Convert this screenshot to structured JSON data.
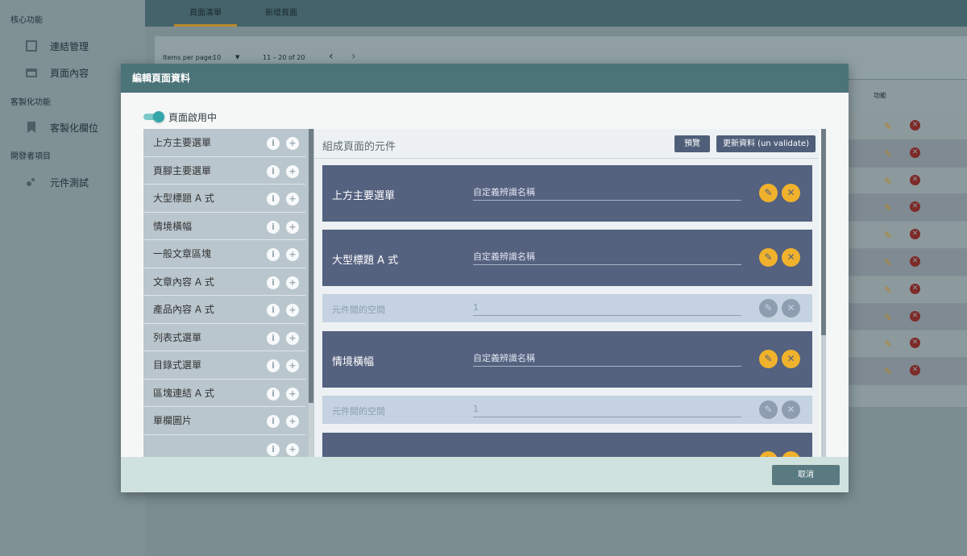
{
  "sidebar": {
    "sections": [
      {
        "label": "核心功能",
        "items": [
          {
            "label": "連結管理",
            "icon": "link-icon"
          },
          {
            "label": "頁面內容",
            "icon": "page-icon"
          }
        ]
      },
      {
        "label": "客製化功能",
        "items": [
          {
            "label": "客製化欄位",
            "icon": "bookmark-icon"
          }
        ]
      },
      {
        "label": "開發者項目",
        "items": [
          {
            "label": "元件測試",
            "icon": "bubbles-icon"
          }
        ]
      }
    ]
  },
  "topbar": {
    "tabs": [
      "頁面清單",
      "新增頁面"
    ]
  },
  "pager": {
    "items_per_page_label": "Items per page:",
    "items_per_page_value": "10",
    "range": "11 – 20 of 20",
    "prev": "‹",
    "next": "›"
  },
  "table": {
    "actions_header": "功能"
  },
  "modal": {
    "title": "編輯頁面資料",
    "toggle_label": "頁面啟用中",
    "component_list": [
      "上方主要選單",
      "頁腳主要選單",
      "大型標題 A 式",
      "情境橫幅",
      "一般文章區塊",
      "文章內容 A 式",
      "產品內容 A 式",
      "列表式選單",
      "目錄式選單",
      "區塊連結 A 式",
      "單欄圖片"
    ],
    "compose": {
      "title": "組成頁面的元件",
      "preview_label": "預覽",
      "update_label": "更新資料 (un validate)",
      "cards": [
        {
          "name": "上方主要選單",
          "field": "自定義辨識名稱"
        },
        {
          "name": "大型標題 A 式",
          "field": "自定義辨識名稱"
        },
        {
          "name": "元件間的空間",
          "field": "1"
        },
        {
          "name": "情境橫幅",
          "field": "自定義辨識名稱"
        },
        {
          "name": "元件間的空間",
          "field": "1"
        }
      ]
    },
    "cancel_label": "取消"
  },
  "colors": {
    "accent": "#f0b22c",
    "header": "#4b7479",
    "card": "#54617f"
  }
}
